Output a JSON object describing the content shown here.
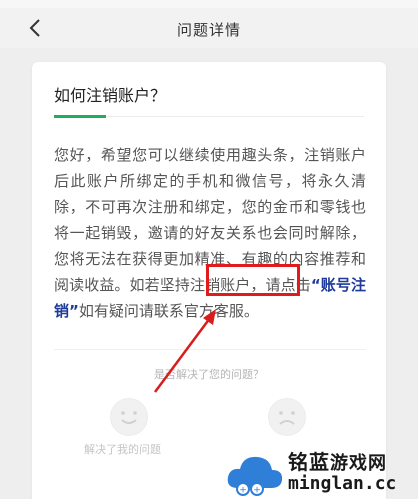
{
  "nav": {
    "title": "问题详情"
  },
  "question": {
    "title": "如何注销账户？"
  },
  "answer": {
    "text_before": "您好，希望您可以继续使用趣头条，注销账户后此账户所绑定的手机和微信号，将永久清除，不可再次注册和绑定，您的金币和零钱也将一起销毁，邀请的好友关系也会同时解除，您将无法在获得更加精准、有趣的内容推荐和阅读收益。如若坚持注销账户，请点击",
    "link_label": "“账号注销”",
    "text_after": "如有疑问请联系官方客服。"
  },
  "feedback": {
    "question": "是否解决了您的问题？",
    "solved_label": "解决了我的问题"
  },
  "watermark": {
    "brand": "铭蓝",
    "brand_suffix": "游戏网",
    "url": "minglan.cc"
  },
  "colors": {
    "accent_green": "#1fae5b",
    "link_blue": "#1e3b9c",
    "annotation_red": "#e11b1b"
  },
  "icons": [
    "back-chevron-icon",
    "smile-face-icon",
    "sad-face-icon",
    "cloud-logo-icon"
  ]
}
